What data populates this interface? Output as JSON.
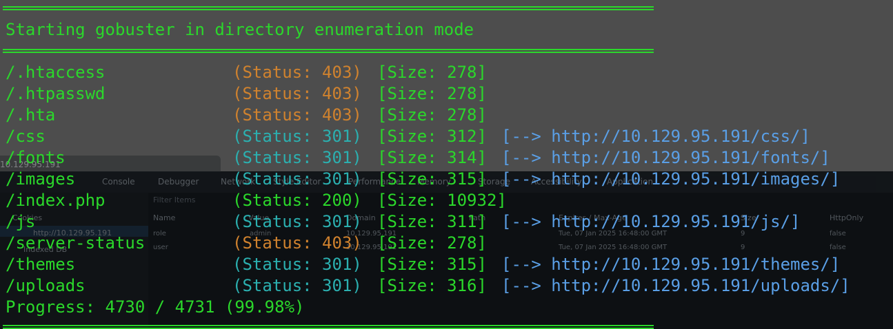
{
  "devtools": {
    "window_title": "10.129.95.191",
    "tabs": [
      "Console",
      "Debugger",
      "Network",
      "Style Editor",
      "Performance",
      "Memory",
      "Storage",
      "Accessibility",
      "Application"
    ],
    "sidebar": [
      "Cookies",
      "http://10.129.95.191",
      "Indexed DB"
    ],
    "filter_placeholder": "Filter Items",
    "columns": [
      "Name",
      "Value",
      "Domain",
      "Path",
      "Expires / Max-Age",
      "Size",
      "HttpOnly"
    ],
    "rows": [
      {
        "name": "role",
        "value": "admin",
        "domain": "10.129.95.191",
        "expires": "Tue, 07 Jan 2025 16:48:00 GMT",
        "size": "9",
        "httponly": "false"
      },
      {
        "name": "user",
        "value": "",
        "domain": "10.129.95.191",
        "expires": "Tue, 07 Jan 2025 16:48:00 GMT",
        "size": "9",
        "httponly": "false"
      }
    ]
  },
  "terminal": {
    "header": "Starting gobuster in directory enumeration mode",
    "results": [
      {
        "path": "/.htaccess",
        "status": "(Status: 403)",
        "size": "[Size: 278]",
        "redirect": ""
      },
      {
        "path": "/.htpasswd",
        "status": "(Status: 403)",
        "size": "[Size: 278]",
        "redirect": ""
      },
      {
        "path": "/.hta",
        "status": "(Status: 403)",
        "size": "[Size: 278]",
        "redirect": ""
      },
      {
        "path": "/css",
        "status": "(Status: 301)",
        "size": "[Size: 312]",
        "redirect": "[--> http://10.129.95.191/css/]"
      },
      {
        "path": "/fonts",
        "status": "(Status: 301)",
        "size": "[Size: 314]",
        "redirect": "[--> http://10.129.95.191/fonts/]"
      },
      {
        "path": "/images",
        "status": "(Status: 301)",
        "size": "[Size: 315]",
        "redirect": "[--> http://10.129.95.191/images/]"
      },
      {
        "path": "/index.php",
        "status": "(Status: 200)",
        "size": "[Size: 10932]",
        "redirect": ""
      },
      {
        "path": "/js",
        "status": "(Status: 301)",
        "size": "[Size: 311]",
        "redirect": "[--> http://10.129.95.191/js/]"
      },
      {
        "path": "/server-status",
        "status": "(Status: 403)",
        "size": "[Size: 278]",
        "redirect": ""
      },
      {
        "path": "/themes",
        "status": "(Status: 301)",
        "size": "[Size: 315]",
        "redirect": "[--> http://10.129.95.191/themes/]"
      },
      {
        "path": "/uploads",
        "status": "(Status: 301)",
        "size": "[Size: 316]",
        "redirect": "[--> http://10.129.95.191/uploads/]"
      }
    ],
    "progress": "Progress: 4730 / 4731 (99.98%)"
  },
  "colors": {
    "green": "#2bd82b",
    "status_403": "#d0822e",
    "status_301": "#2bb0b0",
    "url": "#5a9fe6"
  }
}
